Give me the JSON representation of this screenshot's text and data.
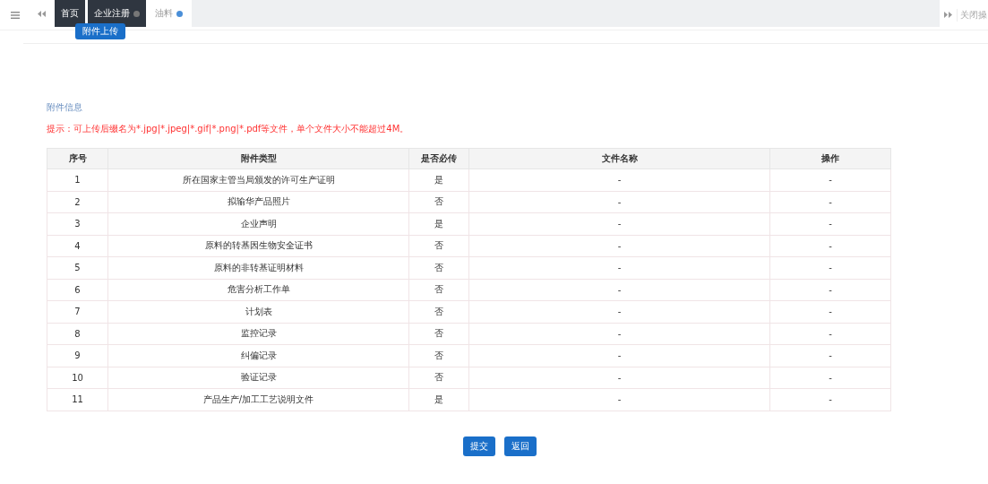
{
  "tabs": [
    {
      "label": "首页",
      "selected": false,
      "closable": false
    },
    {
      "label": "企业注册",
      "selected": false,
      "closable": true
    },
    {
      "label": "油料",
      "selected": true,
      "closable": true
    }
  ],
  "close_menu": "关闭操",
  "upload_button": "附件上传",
  "section_title": "附件信息",
  "hint": "提示：可上传后缀名为*.jpg|*.jpeg|*.gif|*.png|*.pdf等文件，单个文件大小不能超过4M。",
  "table": {
    "columns": [
      "序号",
      "附件类型",
      "是否必传",
      "文件名称",
      "操作"
    ],
    "rows": [
      [
        "1",
        "所在国家主管当局颁发的许可生产证明",
        "是",
        "-",
        "-"
      ],
      [
        "2",
        "拟输华产品照片",
        "否",
        "-",
        "-"
      ],
      [
        "3",
        "企业声明",
        "是",
        "-",
        "-"
      ],
      [
        "4",
        "原料的转基因生物安全证书",
        "否",
        "-",
        "-"
      ],
      [
        "5",
        "原料的非转基证明材料",
        "否",
        "-",
        "-"
      ],
      [
        "6",
        "危害分析工作单",
        "否",
        "-",
        "-"
      ],
      [
        "7",
        "计划表",
        "否",
        "-",
        "-"
      ],
      [
        "8",
        "监控记录",
        "否",
        "-",
        "-"
      ],
      [
        "9",
        "纠偏记录",
        "否",
        "-",
        "-"
      ],
      [
        "10",
        "验证记录",
        "否",
        "-",
        "-"
      ],
      [
        "11",
        "产品生产/加工工艺说明文件",
        "是",
        "-",
        "-"
      ]
    ]
  },
  "buttons": [
    "提交",
    "返回"
  ]
}
